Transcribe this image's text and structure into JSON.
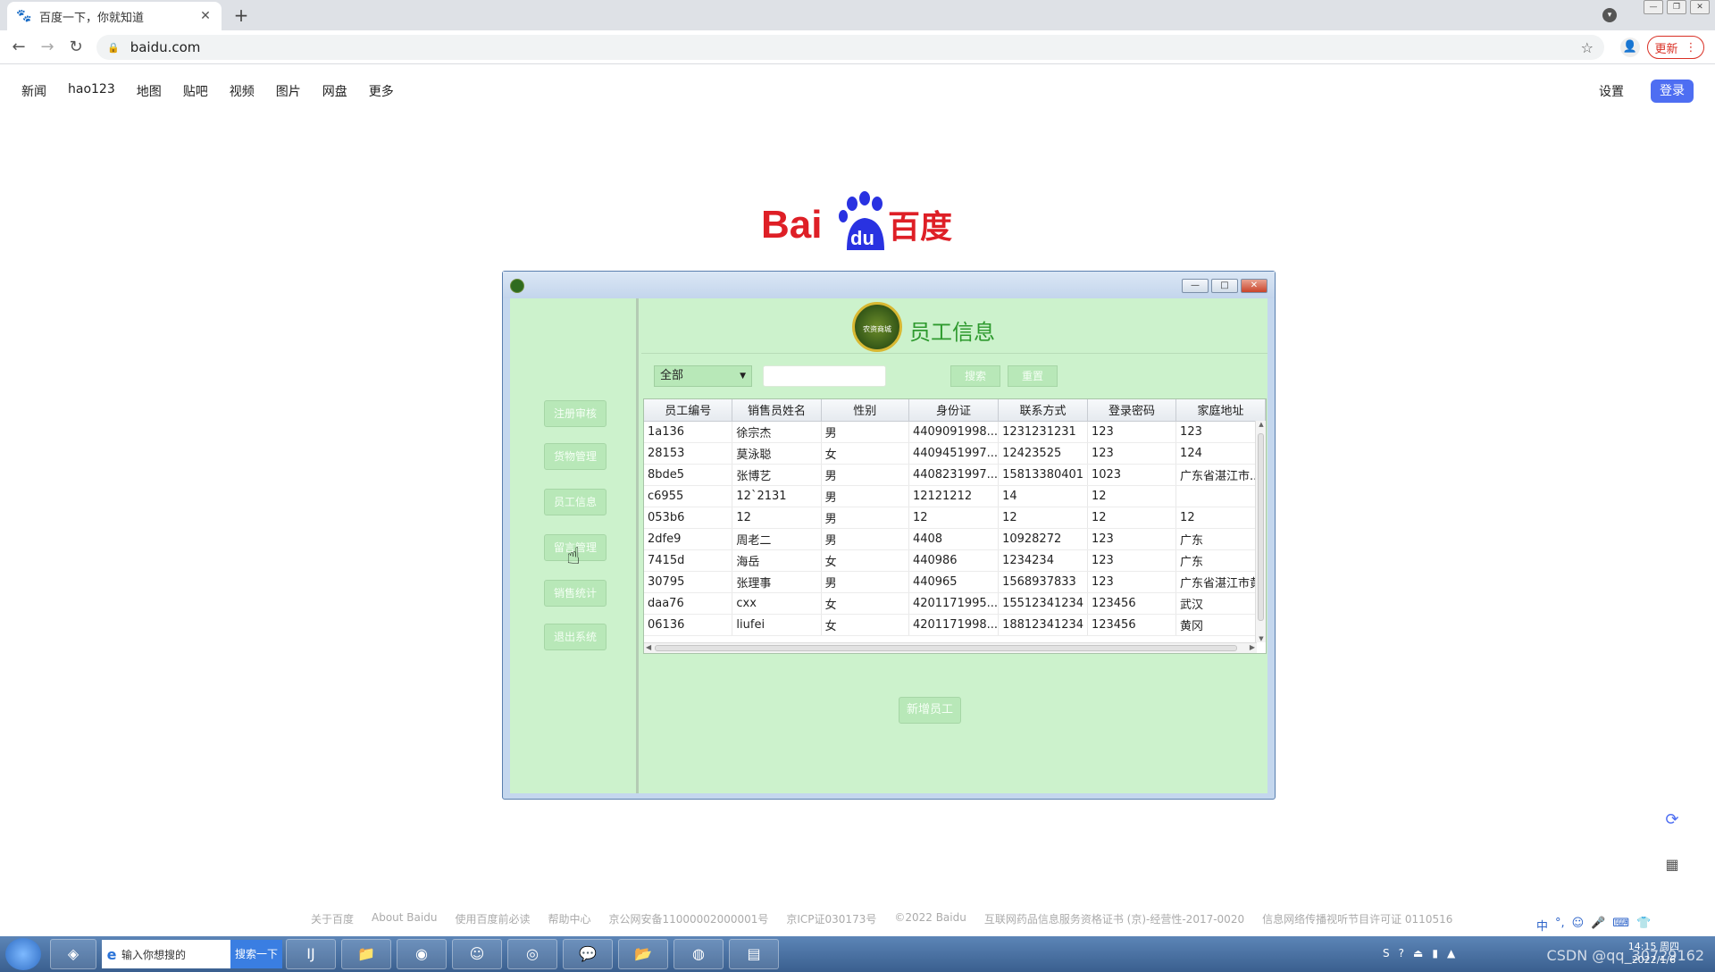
{
  "browser": {
    "tab_title": "百度一下，你就知道",
    "new_tab": "+",
    "url": "baidu.com",
    "update_label": "更新"
  },
  "baidu": {
    "nav": [
      "新闻",
      "hao123",
      "地图",
      "贴吧",
      "视频",
      "图片",
      "网盘",
      "更多"
    ],
    "settings": "设置",
    "login": "登录",
    "logo_text_left": "Bai",
    "logo_text_paw": "du",
    "logo_text_cn": "百度",
    "footer": [
      "关于百度",
      "About Baidu",
      "使用百度前必读",
      "帮助中心",
      "京公网安备11000002000001号",
      "京ICP证030173号",
      "©2022 Baidu",
      "互联网药品信息服务资格证书 (京)-经营性-2017-0020",
      "信息网络传播视听节目许可证 0110516"
    ]
  },
  "app": {
    "header_title": "员工信息",
    "emblem_text": "农资商城",
    "menu": [
      "注册审核",
      "货物管理",
      "员工信息",
      "留言管理",
      "销售统计",
      "退出系统"
    ],
    "filter_selected": "全部",
    "search_label": "搜索",
    "reset_label": "重置",
    "add_label": "新增员工",
    "table": {
      "columns": [
        "员工编号",
        "销售员姓名",
        "性别",
        "身份证",
        "联系方式",
        "登录密码",
        "家庭地址"
      ],
      "rows": [
        [
          "1a136",
          "徐宗杰",
          "男",
          "4409091998...",
          "1231231231",
          "123",
          "123"
        ],
        [
          "28153",
          "莫泳聪",
          "女",
          "4409451997...",
          "12423525",
          "123",
          "124"
        ],
        [
          "8bde5",
          "张博艺",
          "男",
          "4408231997...",
          "15813380401",
          "1023",
          "广东省湛江市..."
        ],
        [
          "c6955",
          "12`2131",
          "男",
          "12121212",
          "14",
          "12",
          ""
        ],
        [
          "053b6",
          "12",
          "男",
          "12",
          "12",
          "12",
          "12"
        ],
        [
          "2dfe9",
          "周老二",
          "男",
          "4408",
          "10928272",
          "123",
          "广东"
        ],
        [
          "7415d",
          "海岳",
          "女",
          "440986",
          "1234234",
          "123",
          "广东"
        ],
        [
          "30795",
          "张理事",
          "男",
          "440965",
          "1568937833",
          "123",
          "广东省湛江市黄"
        ],
        [
          "daa76",
          "cxx",
          "女",
          "4201171995...",
          "15512341234",
          "123456",
          "武汉"
        ],
        [
          "06136",
          "liufei",
          "女",
          "4201171998...",
          "18812341234",
          "123456",
          "黄冈"
        ]
      ]
    }
  },
  "taskbar": {
    "search_placeholder": "输入你想搜的",
    "search_button": "搜索一下",
    "ime": [
      "中",
      "°,",
      "☺",
      "🎤",
      "⌨",
      "👕"
    ],
    "time": "14:15 周四",
    "date": "2022/1/6",
    "watermark": "CSDN @qq_30729162"
  }
}
